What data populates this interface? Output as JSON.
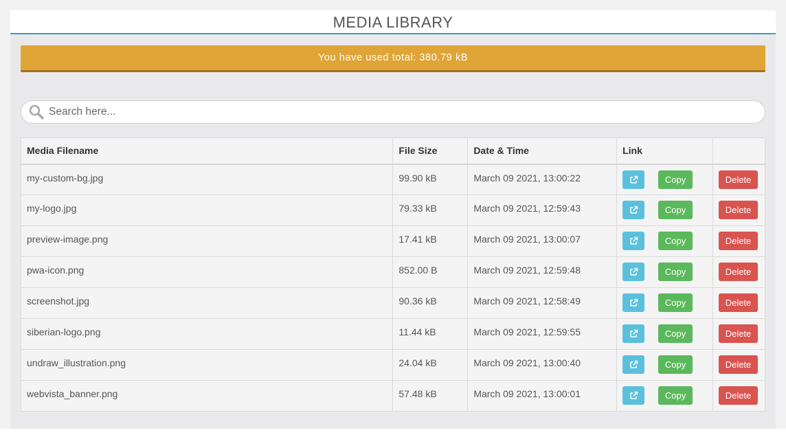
{
  "header": {
    "title": "MEDIA LIBRARY"
  },
  "usage": {
    "text": "You have used total: 380.79 kB"
  },
  "search": {
    "placeholder": "Search here..."
  },
  "table": {
    "columns": [
      "Media Filename",
      "File Size",
      "Date & Time",
      "Link",
      ""
    ],
    "copy_label": "Copy",
    "delete_label": "Delete",
    "open_icon": "external-link-icon",
    "rows": [
      {
        "filename": "my-custom-bg.jpg",
        "size": "99.90 kB",
        "datetime": "March 09 2021, 13:00:22"
      },
      {
        "filename": "my-logo.jpg",
        "size": "79.33 kB",
        "datetime": "March 09 2021, 12:59:43"
      },
      {
        "filename": "preview-image.png",
        "size": "17.41 kB",
        "datetime": "March 09 2021, 13:00:07"
      },
      {
        "filename": "pwa-icon.png",
        "size": "852.00 B",
        "datetime": "March 09 2021, 12:59:48"
      },
      {
        "filename": "screenshot.jpg",
        "size": "90.36 kB",
        "datetime": "March 09 2021, 12:58:49"
      },
      {
        "filename": "siberian-logo.png",
        "size": "11.44 kB",
        "datetime": "March 09 2021, 12:59:55"
      },
      {
        "filename": "undraw_illustration.png",
        "size": "24.04 kB",
        "datetime": "March 09 2021, 13:00:40"
      },
      {
        "filename": "webvista_banner.png",
        "size": "57.48 kB",
        "datetime": "March 09 2021, 13:00:01"
      }
    ]
  },
  "colors": {
    "accent_line": "#2aa4c6",
    "usage_bar": "#dfa536",
    "open_button": "#5bc0de",
    "copy_button": "#5cb85c",
    "delete_button": "#d9534f"
  }
}
